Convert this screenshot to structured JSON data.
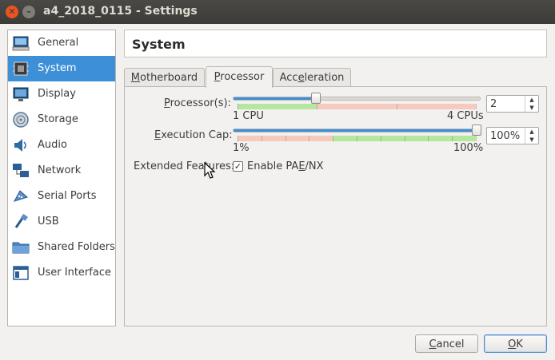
{
  "window": {
    "title": "a4_2018_0115 - Settings",
    "close_glyph": "✕",
    "minimize_glyph": "–"
  },
  "sidebar": {
    "items": [
      {
        "label": "General",
        "icon": "general-icon",
        "selected": false
      },
      {
        "label": "System",
        "icon": "system-icon",
        "selected": true
      },
      {
        "label": "Display",
        "icon": "display-icon",
        "selected": false
      },
      {
        "label": "Storage",
        "icon": "storage-icon",
        "selected": false
      },
      {
        "label": "Audio",
        "icon": "audio-icon",
        "selected": false
      },
      {
        "label": "Network",
        "icon": "network-icon",
        "selected": false
      },
      {
        "label": "Serial Ports",
        "icon": "serial-ports-icon",
        "selected": false
      },
      {
        "label": "USB",
        "icon": "usb-icon",
        "selected": false
      },
      {
        "label": "Shared Folders",
        "icon": "shared-folders-icon",
        "selected": false
      },
      {
        "label": "User Interface",
        "icon": "user-interface-icon",
        "selected": false
      }
    ]
  },
  "header": {
    "title": "System"
  },
  "tabs": [
    {
      "label": "Motherboard",
      "underline": "M",
      "rest": "otherboard",
      "active": false
    },
    {
      "label": "Processor",
      "underline": "P",
      "rest": "rocessor",
      "active": true
    },
    {
      "label": "Acceleration",
      "pre": "Acc",
      "underline": "e",
      "rest": "leration",
      "active": false
    }
  ],
  "processor": {
    "label_pre": "",
    "label_underline": "P",
    "label_rest": "rocessor(s):",
    "min_label": "1 CPU",
    "max_label": "4 CPUs",
    "value": "2",
    "slider_fraction": 0.333
  },
  "execution_cap": {
    "label_underline": "E",
    "label_rest": "xecution Cap:",
    "min_label": "1%",
    "max_label": "100%",
    "value": "100%",
    "slider_fraction": 1.0
  },
  "extended_features": {
    "label": "Extended Features:",
    "checkbox_checked": true,
    "check_glyph": "✓",
    "checkbox_pre": "Enable PA",
    "checkbox_underline": "E",
    "checkbox_rest": "/NX"
  },
  "buttons": {
    "cancel_underline": "C",
    "cancel_rest": "ancel",
    "ok_underline": "O",
    "ok_rest": "K"
  },
  "colors": {
    "accent": "#3d8fd8",
    "range_good": "#b6e6a0",
    "range_bad": "#f6cbbd",
    "titlebar": "#3c3b37"
  }
}
